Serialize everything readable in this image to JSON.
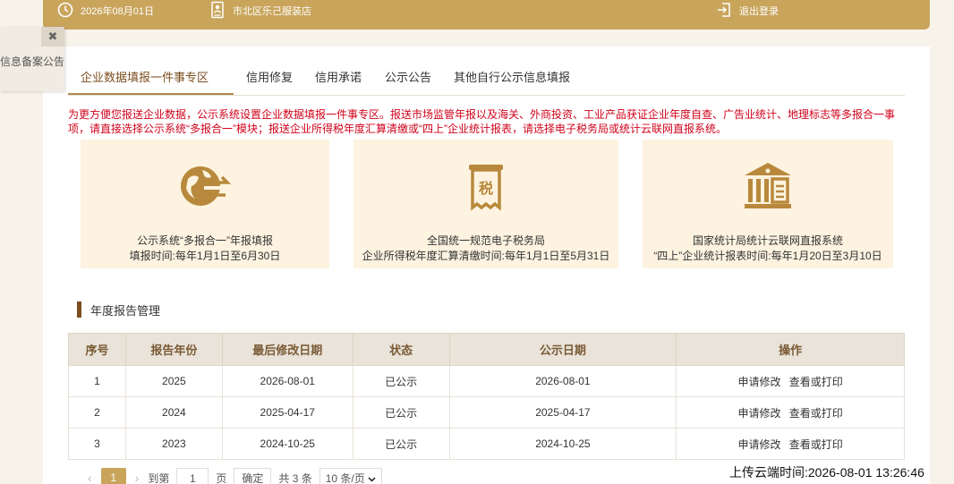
{
  "header": {
    "date": "2026年08月01日",
    "store": "市北区乐己服装店",
    "logout": "退出登录"
  },
  "notice_popup": {
    "close": "✖",
    "text": "信息备案公告"
  },
  "tabs": [
    {
      "label": "企业数据填报一件事专区",
      "active": true
    },
    {
      "label": "信用修复",
      "active": false
    },
    {
      "label": "信用承诺",
      "active": false
    },
    {
      "label": "公示公告",
      "active": false
    },
    {
      "label": "其他自行公示信息填报",
      "active": false
    }
  ],
  "description": "为更方便您报送企业数据，公示系统设置企业数据填报一件事专区。报送市场监管年报以及海关、外商投资、工业产品获证企业年度自查、广告业统计、地理标志等多报合一事项，请直接选择公示系统“多报合一”模块；报送企业所得税年度汇算清缴或“四上”企业统计报表，请选择电子税务局或统计云联网直报系统。",
  "cards": [
    {
      "icon": "globe-exchange-icon",
      "line1": "公示系统“多报合一”年报填报",
      "line2": "填报时间:每年1月1日至6月30日"
    },
    {
      "icon": "tax-receipt-icon",
      "line1": "全国统一规范电子税务局",
      "line2": "企业所得税年度汇算清缴时间:每年1月1日至5月31日"
    },
    {
      "icon": "government-building-icon",
      "line1": "国家统计局统计云联网直报系统",
      "line2": "“四上”企业统计报表时间:每年1月20日至3月10日"
    }
  ],
  "section_title": "年度报告管理",
  "table": {
    "headers": [
      "序号",
      "报告年份",
      "最后修改日期",
      "状态",
      "公示日期",
      "操作"
    ],
    "rows": [
      {
        "no": "1",
        "year": "2025",
        "modified": "2026-08-01",
        "status": "已公示",
        "publish": "2026-08-01"
      },
      {
        "no": "2",
        "year": "2024",
        "modified": "2025-04-17",
        "status": "已公示",
        "publish": "2025-04-17"
      },
      {
        "no": "3",
        "year": "2023",
        "modified": "2024-10-25",
        "status": "已公示",
        "publish": "2024-10-25"
      }
    ],
    "op_modify": "申请修改",
    "op_view": "查看或打印"
  },
  "pager": {
    "prev": "‹",
    "next": "›",
    "current": "1",
    "goto_label": "到第",
    "goto_value": "1",
    "page_label": "页",
    "confirm": "确定",
    "total": "共 3 条",
    "page_size": "10 条/页"
  },
  "upload_time": "上传云端时间:2026-08-01 13:26:46",
  "colors": {
    "brand_gold": "#c9a55c",
    "brand_brown": "#7a4e1e",
    "warning_red": "#d0021b",
    "card_bg": "#fdf3e0"
  }
}
